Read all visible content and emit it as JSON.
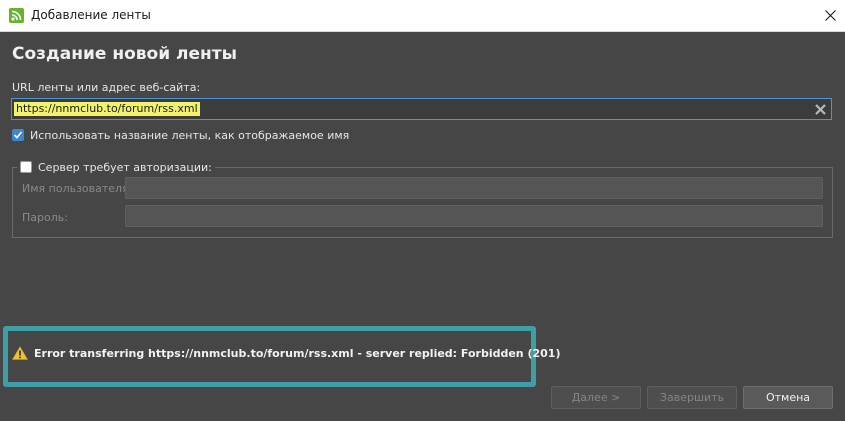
{
  "window": {
    "title": "Добавление ленты"
  },
  "dialog": {
    "heading": "Создание новой ленты",
    "url_label": "URL ленты или адрес веб-сайта:",
    "url_value": "https://nnmclub.to/forum/rss.xml",
    "use_feed_name_label": "Использовать название ленты, как отображаемое имя",
    "use_feed_name_checked": true,
    "auth": {
      "legend": "Сервер требует авторизации:",
      "checked": false,
      "username_label": "Имя пользователя:",
      "username_value": "",
      "password_label": "Пароль:",
      "password_value": ""
    },
    "error": {
      "message": "Error transferring https://nnmclub.to/forum/rss.xml - server replied: Forbidden (201)"
    }
  },
  "buttons": {
    "next": "Далее >",
    "finish": "Завершить",
    "cancel": "Отмена"
  },
  "colors": {
    "background": "#464646",
    "accent": "#3f86d0",
    "highlight": "#3f9fa6",
    "url_selection": "#f3f36b",
    "warning": "#f0c030"
  }
}
